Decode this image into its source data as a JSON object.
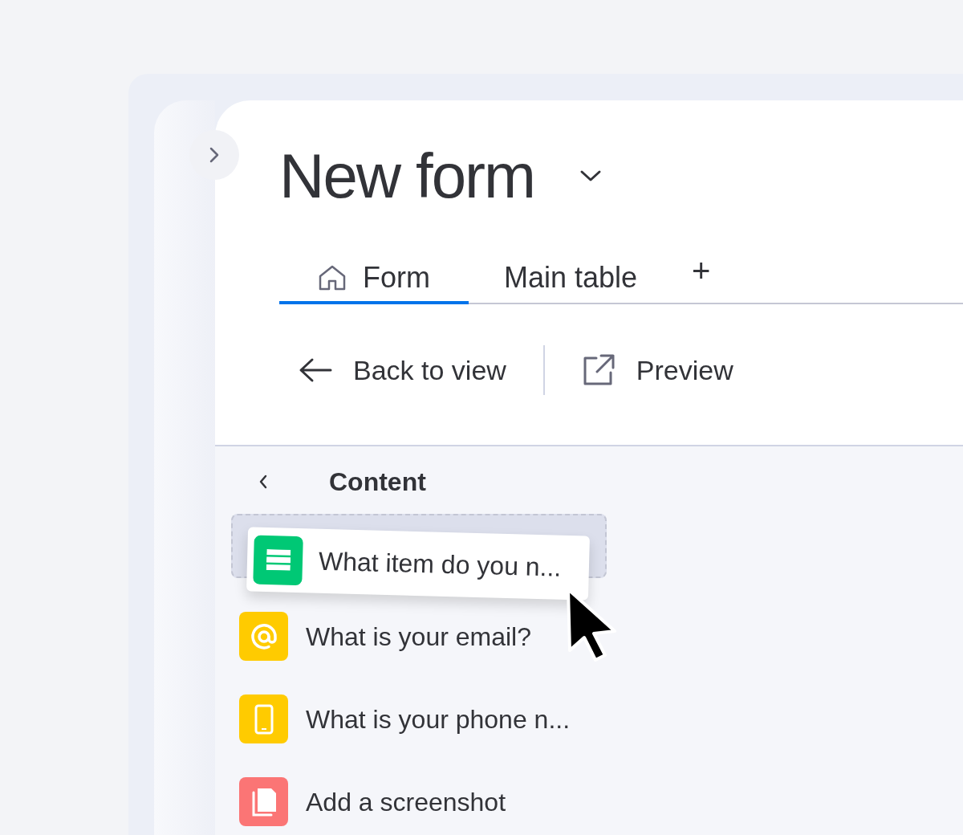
{
  "title": "New form",
  "tabs": [
    {
      "label": "Form",
      "kind": "home",
      "selected": true
    },
    {
      "label": "Main table",
      "kind": "plain",
      "selected": false
    }
  ],
  "add_tab": "+",
  "toolbar": [
    {
      "kind": "back",
      "label": "Back to view"
    },
    {
      "kind": "preview",
      "label": "Preview"
    }
  ],
  "panel": {
    "title": "Content"
  },
  "questions": [
    {
      "kind": "list",
      "label": "What item do you n...",
      "color": "#00c875",
      "dragging": true
    },
    {
      "kind": "email",
      "label": "What is your email?",
      "color": "#ffcb00",
      "dragging": false
    },
    {
      "kind": "phone",
      "label": "What is your phone n...",
      "color": "#ffcb00",
      "dragging": false
    },
    {
      "kind": "file",
      "label": "Add a screenshot",
      "color": "#fb7575",
      "dragging": false
    }
  ]
}
